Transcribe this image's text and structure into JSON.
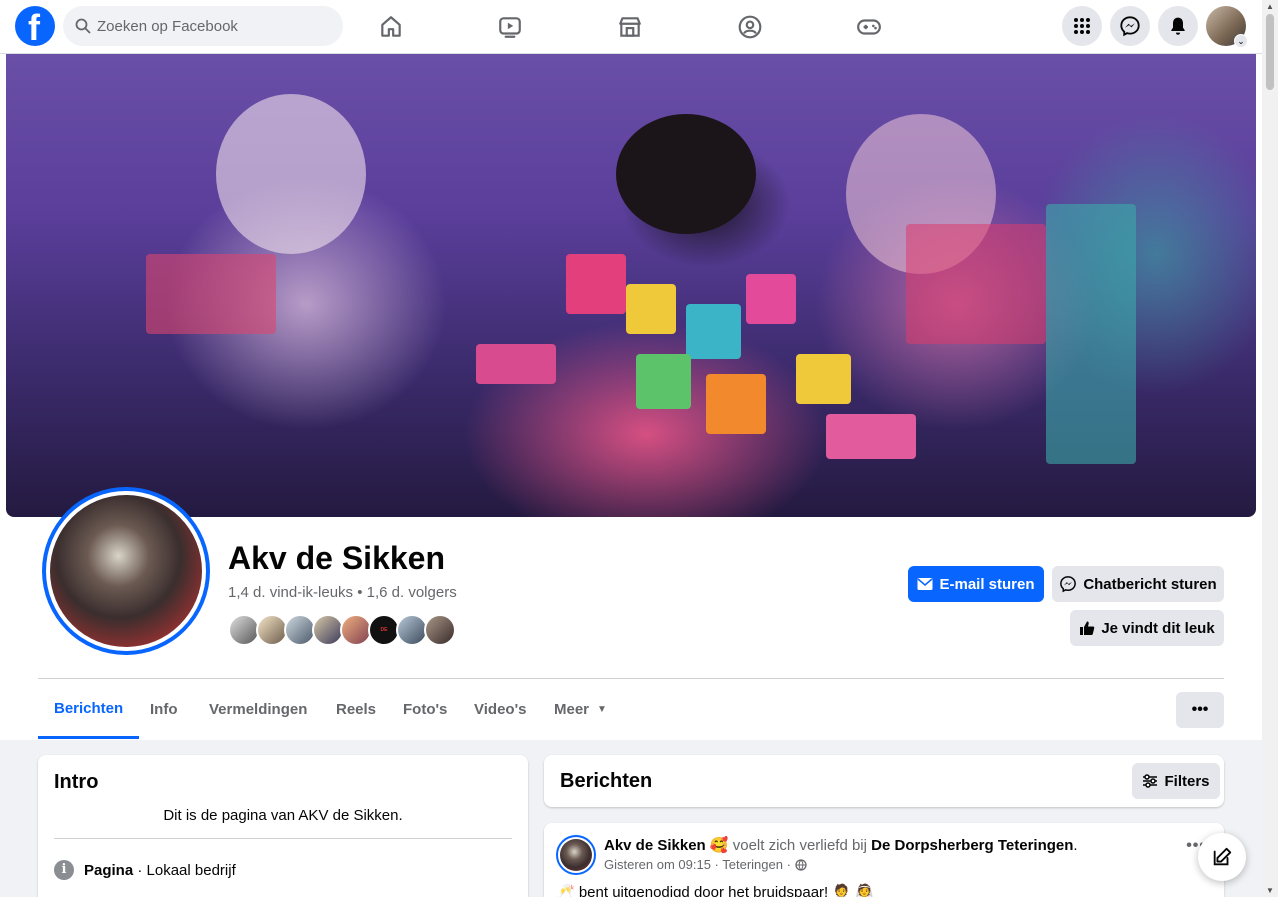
{
  "topnav": {
    "logo_letter": "f",
    "search_placeholder": "Zoeken op Facebook",
    "nav_icons": [
      "home-icon",
      "video-icon",
      "marketplace-icon",
      "groups-icon",
      "gaming-icon"
    ],
    "right_icons": [
      "menu-grid-icon",
      "messenger-icon",
      "notifications-icon"
    ],
    "account_chevron": "⌄"
  },
  "page": {
    "name": "Akv de Sikken",
    "stats": "1,4 d. vind-ik-leuks • 1,6 d. volgers",
    "fan_avatar_count": 8,
    "fan_avatar_badge": "DE LANTAA"
  },
  "actions": {
    "email": "E-mail sturen",
    "chat": "Chatbericht sturen",
    "like": "Je vindt dit leuk"
  },
  "tabs": [
    {
      "label": "Berichten",
      "active": true
    },
    {
      "label": "Info",
      "active": false
    },
    {
      "label": "Vermeldingen",
      "active": false
    },
    {
      "label": "Reels",
      "active": false
    },
    {
      "label": "Foto's",
      "active": false
    },
    {
      "label": "Video's",
      "active": false
    },
    {
      "label": "Meer",
      "active": false
    }
  ],
  "tabs_more_menu": "•••",
  "intro": {
    "title": "Intro",
    "description": "Dit is de pagina van AKV de Sikken.",
    "category_label": "Pagina",
    "category_value": " · Lokaal bedrijf"
  },
  "posts": {
    "title": "Berichten",
    "filters": "Filters",
    "first_post": {
      "author": "Akv de Sikken",
      "emoji": "🥰",
      "feeling": "voelt zich verliefd bij",
      "place": "De Dorpsherberg Teteringen",
      "time": "Gisteren om 09:15 · Teteringen ·",
      "text": "🥂 bent uitgenodigd door het bruidspaar! 🤵 👰",
      "menu": "•••"
    }
  },
  "colors": {
    "brand_blue": "#0866ff",
    "secondary_button": "#e4e6eb",
    "page_bg": "#f0f2f5",
    "muted_text": "#65676b"
  }
}
